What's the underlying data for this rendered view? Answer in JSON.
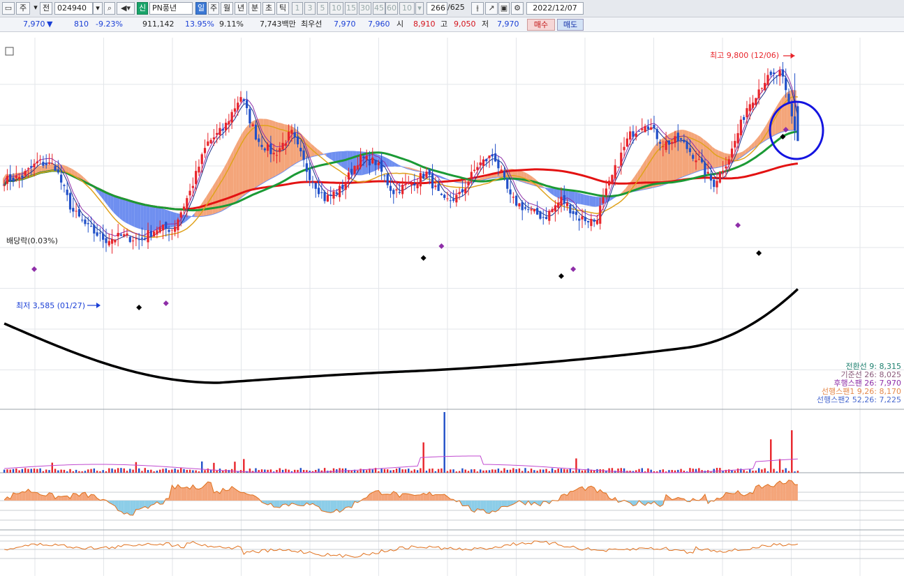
{
  "toolbar": {
    "market": "주",
    "prev": "전",
    "code": "024940",
    "shin": "신",
    "name": "PN풍년",
    "periods": [
      "일",
      "주",
      "월",
      "년",
      "분",
      "초",
      "틱"
    ],
    "active_period": "일",
    "minutes": [
      "1",
      "3",
      "5",
      "10",
      "15",
      "30",
      "45",
      "60",
      "10"
    ],
    "count": "266",
    "total": "/625",
    "date": "2022/12/07"
  },
  "quote": {
    "price": "7,970",
    "arrow": "▼",
    "change": "810",
    "change_pct": "-9.23%",
    "volume": "911,142",
    "turnover": "13.95%",
    "ratio": "9.11%",
    "amount": "7,743백만",
    "best_label": "최우선",
    "best_ask": "7,970",
    "best_bid": "7,960",
    "open_label": "시",
    "open": "8,910",
    "high_label": "고",
    "high": "9,050",
    "low_label": "저",
    "low": "7,970",
    "buy_button": "매수",
    "sell_button": "매도"
  },
  "annotations": {
    "high": "최고 9,800 (12/06)",
    "low": "최저 3,585 (01/27)",
    "dividend": "배당락(0.03%)"
  },
  "legend": [
    {
      "label": "전환선 9: 8,315",
      "color": "#1c7f6e"
    },
    {
      "label": "기준선 26: 8,025",
      "color": "#8a5a7a"
    },
    {
      "label": "후행스팬 26: 7,970",
      "color": "#8e2ea8"
    },
    {
      "label": "선행스팬1 9,26: 8,170",
      "color": "#e58a4e"
    },
    {
      "label": "선행스팬2 52,26: 7,225",
      "color": "#4a6ad0"
    }
  ],
  "colors": {
    "up": "#e8242a",
    "down": "#2150c8",
    "ma_red": "#e31212",
    "ma_green": "#1b9a35",
    "ma_gold": "#e0a21c",
    "ma_black": "#000000",
    "cloud_orange": "#f4a57a",
    "cloud_blue": "#6f8ff0",
    "tenkan": "#1a2f8a",
    "chikou": "#8e2ea8",
    "circle": "#1414e0"
  },
  "chart_data": {
    "type": "candlestick",
    "x_range": [
      "2022/01",
      "2022/12/07"
    ],
    "ylim": [
      3000,
      10500
    ],
    "high": {
      "value": 9800,
      "date": "12/06"
    },
    "low": {
      "value": 3585,
      "date": "01/27"
    },
    "ohlc_shape": [
      6.9,
      7.0,
      7.4,
      7.3,
      6.1,
      5.6,
      5.3,
      5.4,
      5.3,
      5.6,
      5.6,
      6.6,
      7.9,
      8.3,
      9.2,
      8.0,
      7.6,
      8.2,
      7.1,
      6.4,
      6.7,
      7.5,
      7.4,
      6.6,
      6.8,
      7.1,
      6.3,
      6.5,
      7.3,
      7.6,
      6.4,
      6.1,
      5.9,
      6.4,
      5.9,
      5.8,
      7.0,
      8.1,
      8.5,
      7.9,
      8.0,
      7.5,
      6.8,
      7.6,
      8.9,
      9.6,
      9.8,
      7.97
    ],
    "last": {
      "close": 7970,
      "open": 8910,
      "high": 9050,
      "low": 7970
    }
  }
}
